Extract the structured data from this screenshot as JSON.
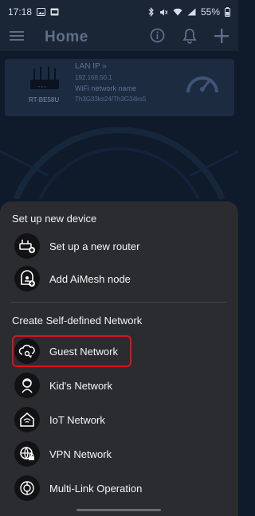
{
  "status_bar": {
    "time": "17:18",
    "battery": "55%",
    "icons": [
      "image-icon",
      "gallery-icon",
      "bluetooth-icon",
      "mute-icon",
      "wifi-icon",
      "signal-icon",
      "battery-icon"
    ]
  },
  "header": {
    "title": "Home",
    "icons": [
      "menu-icon",
      "info-icon",
      "bell-icon",
      "plus-icon"
    ]
  },
  "router_card": {
    "router_name": "RT-BE58U",
    "lan_ip_label": "LAN IP",
    "lan_ip": "192.168.50.1",
    "wifi_label": "WiFi network name",
    "wifi_name": "Th3G33ks24/Th3G34ks5"
  },
  "sheet": {
    "section1_title": "Set up new device",
    "section1_items": [
      {
        "label": "Set up a new router",
        "icon": "router-plus-icon"
      },
      {
        "label": "Add AiMesh node",
        "icon": "aimesh-node-icon"
      }
    ],
    "section2_title": "Create Self-defined Network",
    "section2_items": [
      {
        "label": "Guest Network",
        "icon": "guest-network-icon"
      },
      {
        "label": "Kid's Network",
        "icon": "kids-network-icon"
      },
      {
        "label": "IoT Network",
        "icon": "iot-network-icon"
      },
      {
        "label": "VPN Network",
        "icon": "vpn-network-icon"
      },
      {
        "label": "Multi-Link Operation",
        "icon": "multi-link-icon"
      }
    ]
  },
  "colors": {
    "sheet_bg": "#2b2c30",
    "highlight": "#d8141f",
    "app_bg": "#0f1a2a"
  }
}
